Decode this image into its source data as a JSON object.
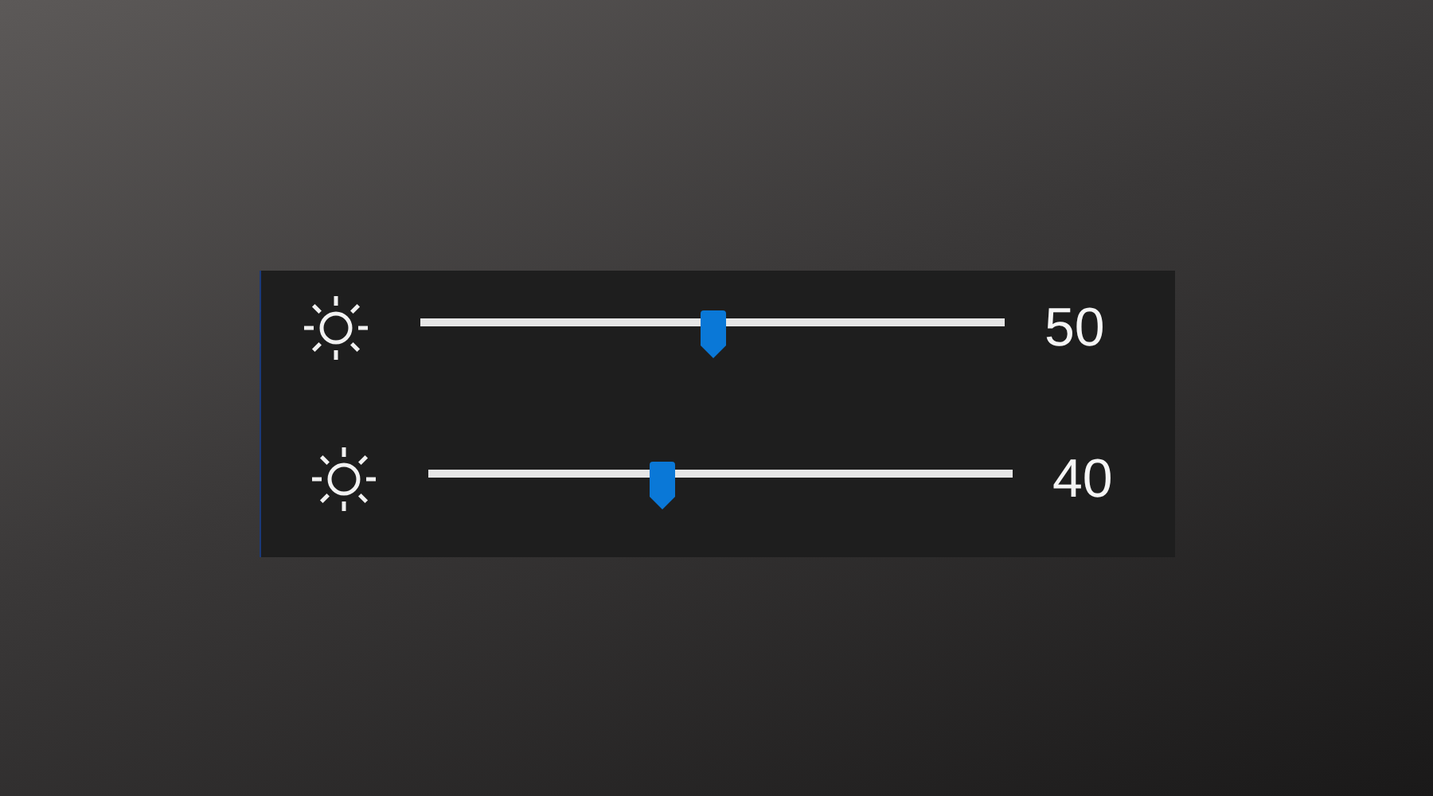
{
  "sliders": [
    {
      "level": 0.5,
      "reading": "50"
    },
    {
      "level": 0.4,
      "reading": "40"
    }
  ]
}
